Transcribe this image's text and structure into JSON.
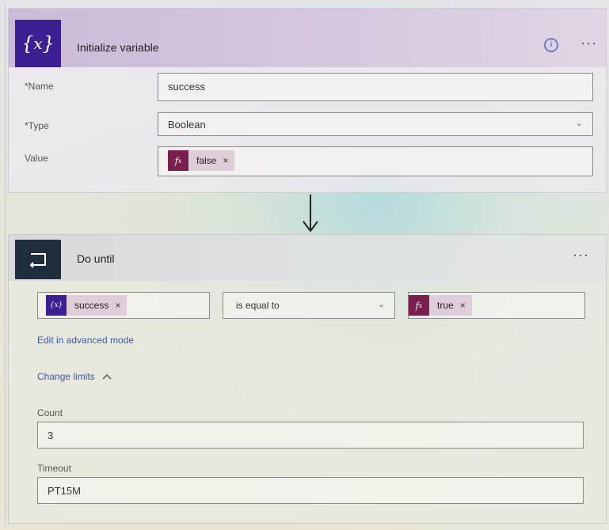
{
  "init_variable": {
    "icon": "variable-icon",
    "title": "Initialize variable",
    "info_icon": "info-icon",
    "menu": "···",
    "name_label": "*Name",
    "name_value": "success",
    "type_label": "*Type",
    "type_value": "Boolean",
    "value_label": "Value",
    "value_token": {
      "icon": "fx-icon",
      "icon_text": "fx",
      "label": "false",
      "remove": "×"
    }
  },
  "connector": {
    "icon": "down-arrow-icon"
  },
  "do_until": {
    "icon": "loop-icon",
    "title": "Do until",
    "menu": "···",
    "condition": {
      "left_token": {
        "icon": "variable-icon",
        "icon_text": "{x}",
        "label": "success",
        "remove": "×"
      },
      "operator": "is equal to",
      "right_token": {
        "icon": "fx-icon",
        "icon_text": "fx",
        "label": "true",
        "remove": "×"
      }
    },
    "advanced_mode_link": "Edit in advanced mode",
    "change_limits_label": "Change limits",
    "count_label": "Count",
    "count_value": "3",
    "timeout_label": "Timeout",
    "timeout_value": "PT15M"
  },
  "colors": {
    "variable_purple": "#3b1f93",
    "fx_maroon": "#7a1d4f",
    "loop_dark": "#1f2d3d",
    "link_blue": "#3f58a8"
  }
}
